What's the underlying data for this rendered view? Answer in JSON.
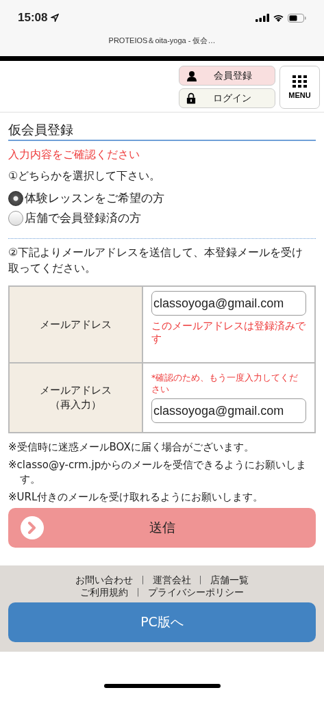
{
  "status_bar": {
    "time": "15:08"
  },
  "browser": {
    "title": "PROTEIOS＆oita-yoga - 仮会…"
  },
  "header": {
    "buttons": [
      {
        "kind": "register",
        "label": "会員登録"
      },
      {
        "kind": "login",
        "label": "ログイン"
      }
    ],
    "menu": "MENU"
  },
  "page_title": "仮会員登録",
  "error": "入力内容をご確認ください",
  "step1": "①どちらかを選択して下さい。",
  "options": [
    {
      "label": "体験レッスンをご希望の方",
      "selected": true
    },
    {
      "label": "店舗で会員登録済の方",
      "selected": false
    }
  ],
  "step2": "②下記よりメールアドレスを送信して、本登録メールを受け取ってください。",
  "form": [
    {
      "label": "メールアドレス",
      "value": "classoyoga@gmail.com",
      "error": "このメールアドレスは登録済みです"
    },
    {
      "label": "メールアドレス",
      "sublabel": "（再入力）",
      "hint": "*確認のため、もう一度入力してください",
      "value": "classoyoga@gmail.com"
    }
  ],
  "notes": [
    "※受信時に迷惑メールBOXに届く場合がございます。",
    "※classo@y-crm.jpからのメールを受信できるようにお願いします。",
    "※URL付きのメールを受け取れるようにお願いします。"
  ],
  "submit": "送信",
  "footer": {
    "rows": [
      [
        {
          "kind": "link",
          "label": "お問い合わせ"
        },
        {
          "kind": "separator",
          "label": "|"
        },
        {
          "kind": "link",
          "label": "運営会社"
        },
        {
          "kind": "separator",
          "label": "|"
        },
        {
          "kind": "link",
          "label": "店舗一覧"
        }
      ],
      [
        {
          "kind": "link",
          "label": "ご利用規約"
        },
        {
          "kind": "separator",
          "label": "|"
        },
        {
          "kind": "link",
          "label": "プライバシーポリシー"
        }
      ]
    ],
    "pc_button": "PC版へ"
  }
}
